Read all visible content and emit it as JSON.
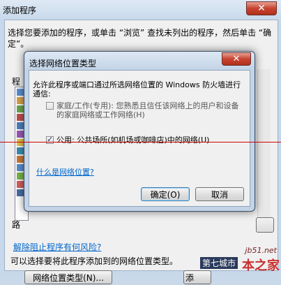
{
  "outer": {
    "title": "添加程序",
    "instruction": "选择您要添加的程序，或单击 “浏览” 查找未列出的程序，然后单击 “确定”。",
    "list_label": "程",
    "path_label": "路",
    "risk_link": "解除阻止程序有何风险?",
    "desc": "可以选择要将此程序添加到的网络位置类型。",
    "nettype_button": "网络位置类型(N)...",
    "add_button": "添"
  },
  "dialog": {
    "title": "选择网络位置类型",
    "close_glyph": "✕",
    "message": "允许此程序或端口通过所选网络位置的 Windows 防火墙进行通信:",
    "options": [
      {
        "label": "家庭/工作(专用): 您熟悉且信任该网络上的用户和设备的家庭网络或工作网络(H)",
        "checked": false
      },
      {
        "label": "公用: 公共场所(如机场或咖啡店)中的网络(U)",
        "checked": true
      }
    ],
    "what_link": "什么是网络位置?",
    "ok_button": "确定(O)",
    "cancel_button": "取消"
  },
  "colors": {
    "accent_link": "#0066cc",
    "close_button": "#c7432f",
    "overlay_line": "#d40000"
  },
  "watermark": {
    "url": "jb51.net",
    "site": "第七城市",
    "word": "本之家"
  }
}
